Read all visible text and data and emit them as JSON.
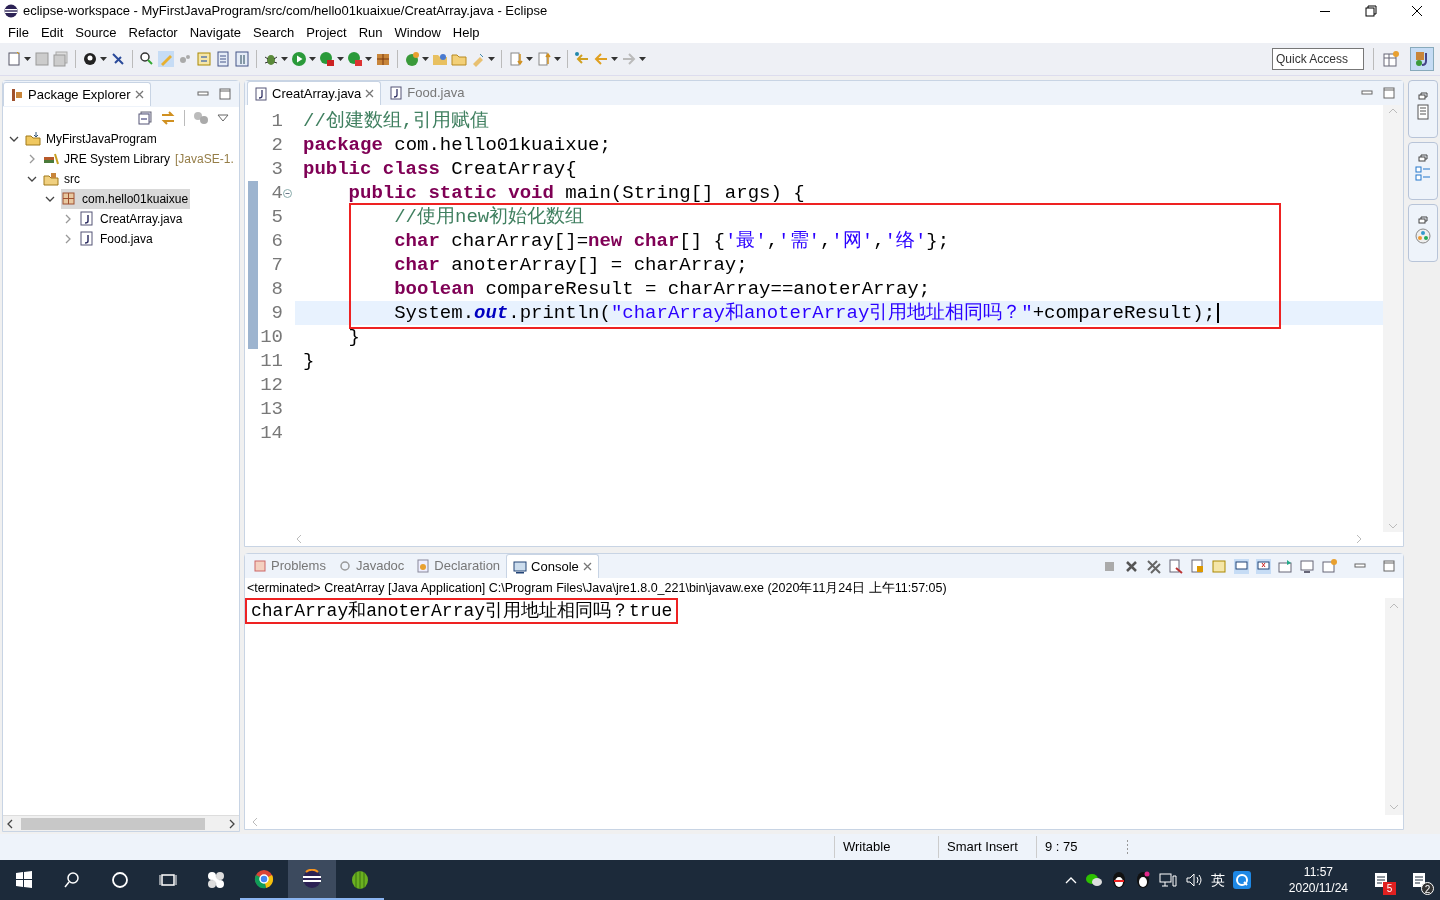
{
  "window": {
    "title": "eclipse-workspace - MyFirstJavaProgram/src/com/hello01kuaixue/CreatArray.java - Eclipse"
  },
  "menu": [
    "File",
    "Edit",
    "Source",
    "Refactor",
    "Navigate",
    "Search",
    "Project",
    "Run",
    "Window",
    "Help"
  ],
  "quick_access": {
    "placeholder": "Quick Access"
  },
  "package_explorer": {
    "title": "Package Explorer",
    "tree": [
      {
        "label": "MyFirstJavaProgram",
        "kind": "project",
        "expanded": true,
        "selected": false,
        "children": [
          {
            "label": "JRE System Library",
            "decoration": "[JavaSE-1.",
            "kind": "library",
            "expanded": false,
            "selected": false
          },
          {
            "label": "src",
            "kind": "folder",
            "expanded": true,
            "selected": false,
            "children": [
              {
                "label": "com.hello01kuaixue",
                "kind": "package",
                "expanded": true,
                "selected": true,
                "children": [
                  {
                    "label": "CreatArray.java",
                    "kind": "file",
                    "expanded": false,
                    "selected": false
                  },
                  {
                    "label": "Food.java",
                    "kind": "file",
                    "expanded": false,
                    "selected": false
                  }
                ]
              }
            ]
          }
        ]
      }
    ]
  },
  "editor": {
    "tabs": [
      {
        "label": "CreatArray.java",
        "selected": true
      },
      {
        "label": "Food.java",
        "selected": false
      }
    ],
    "lines": [
      {
        "number": "1",
        "segments": [
          {
            "kind": "comment",
            "text": "//创建数组,引用赋值"
          }
        ]
      },
      {
        "number": "2",
        "segments": [
          {
            "kind": "keyword",
            "text": "package"
          },
          {
            "kind": "plain",
            "text": " com.hello01kuaixue;"
          }
        ]
      },
      {
        "number": "3",
        "segments": [
          {
            "kind": "keyword",
            "text": "public class"
          },
          {
            "kind": "plain",
            "text": " CreatArray{"
          }
        ]
      },
      {
        "number": "4",
        "fold": true,
        "segments": [
          {
            "kind": "keyword",
            "text": "    public static void"
          },
          {
            "kind": "plain",
            "text": " main(String[] args) {"
          }
        ]
      },
      {
        "number": "5",
        "boxed": true,
        "segments": [
          {
            "kind": "comment",
            "text": "        //使用new初始化数组"
          }
        ]
      },
      {
        "number": "6",
        "boxed": true,
        "segments": [
          {
            "kind": "keyword",
            "text": "        char"
          },
          {
            "kind": "plain",
            "text": " charArray[]="
          },
          {
            "kind": "keyword",
            "text": "new char"
          },
          {
            "kind": "plain",
            "text": "[] {"
          },
          {
            "kind": "string",
            "text": "'最'"
          },
          {
            "kind": "plain",
            "text": ","
          },
          {
            "kind": "string",
            "text": "'需'"
          },
          {
            "kind": "plain",
            "text": ","
          },
          {
            "kind": "string",
            "text": "'网'"
          },
          {
            "kind": "plain",
            "text": ","
          },
          {
            "kind": "string",
            "text": "'络'"
          },
          {
            "kind": "plain",
            "text": "};"
          }
        ]
      },
      {
        "number": "7",
        "boxed": true,
        "segments": [
          {
            "kind": "keyword",
            "text": "        char"
          },
          {
            "kind": "plain",
            "text": " anoterArray[] = charArray;"
          }
        ]
      },
      {
        "number": "8",
        "boxed": true,
        "segments": [
          {
            "kind": "keyword",
            "text": "        boolean"
          },
          {
            "kind": "plain",
            "text": " compareResult = charArray==anoterArray;"
          }
        ]
      },
      {
        "number": "9",
        "boxed": true,
        "current": true,
        "segments": [
          {
            "kind": "plain",
            "text": "        System."
          },
          {
            "kind": "field",
            "text": "out"
          },
          {
            "kind": "plain",
            "text": ".println("
          },
          {
            "kind": "string",
            "text": "\"charArray和anoterArray引用地址相同吗？\""
          },
          {
            "kind": "plain",
            "text": "+compareResult);"
          }
        ]
      },
      {
        "number": "10",
        "segments": [
          {
            "kind": "plain",
            "text": "    }"
          }
        ]
      },
      {
        "number": "11",
        "segments": [
          {
            "kind": "plain",
            "text": "}"
          }
        ]
      },
      {
        "number": "12"
      },
      {
        "number": "13"
      },
      {
        "number": "14"
      }
    ]
  },
  "console": {
    "tabs": [
      {
        "label": "Problems",
        "selected": false
      },
      {
        "label": "Javadoc",
        "selected": false
      },
      {
        "label": "Declaration",
        "selected": false
      },
      {
        "label": "Console",
        "selected": true
      }
    ],
    "header": "<terminated> CreatArray [Java Application] C:\\Program Files\\Java\\jre1.8.0_221\\bin\\javaw.exe (2020年11月24日 上午11:57:05)",
    "output": [
      {
        "text": "charArray和anoterArray引用地址相同吗？true",
        "boxed": true
      }
    ]
  },
  "status_bar": [
    "Writable",
    "Smart Insert",
    "9 : 75"
  ],
  "taskbar": {
    "ime": "英",
    "time": "11:57",
    "date": "2020/11/24",
    "badges": [
      "5",
      "2"
    ]
  }
}
